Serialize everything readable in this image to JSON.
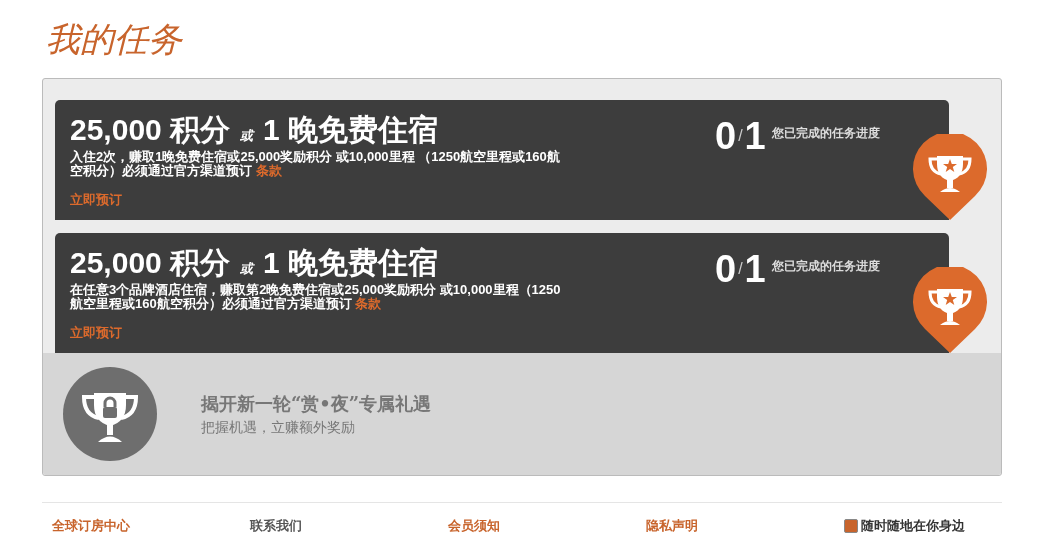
{
  "page_title": "我的任务",
  "tasks": [
    {
      "points": "25,000 积分",
      "or": "或",
      "nights": "1 晚免费住宿",
      "description": "入住2次，赚取1晚免费住宿或25,000奖励积分 或10,000里程 （1250航空里程或160航空积分）必须通过官方渠道预订",
      "terms_link": "条款",
      "book_link": "立即预订",
      "done": "0",
      "separator": "/",
      "total": "1",
      "progress_label": "您已完成的任务进度"
    },
    {
      "points": "25,000 积分",
      "or": "或",
      "nights": "1 晚免费住宿",
      "description": "在任意3个品牌酒店住宿，赚取第2晚免费住宿或25,000奖励积分 或10,000里程（1250航空里程或160航空积分）必须通过官方渠道预订",
      "terms_link": "条款",
      "book_link": "立即预订",
      "done": "0",
      "separator": "/",
      "total": "1",
      "progress_label": "您已完成的任务进度"
    }
  ],
  "locked": {
    "title": "揭开新一轮“赏•夜”专属礼遇",
    "subtitle": "把握机遇，立赚额外奖励"
  },
  "footer_links": [
    "全球订房中心",
    "联系我们",
    "会员须知",
    "隐私声明",
    "随时随地在你身边"
  ]
}
